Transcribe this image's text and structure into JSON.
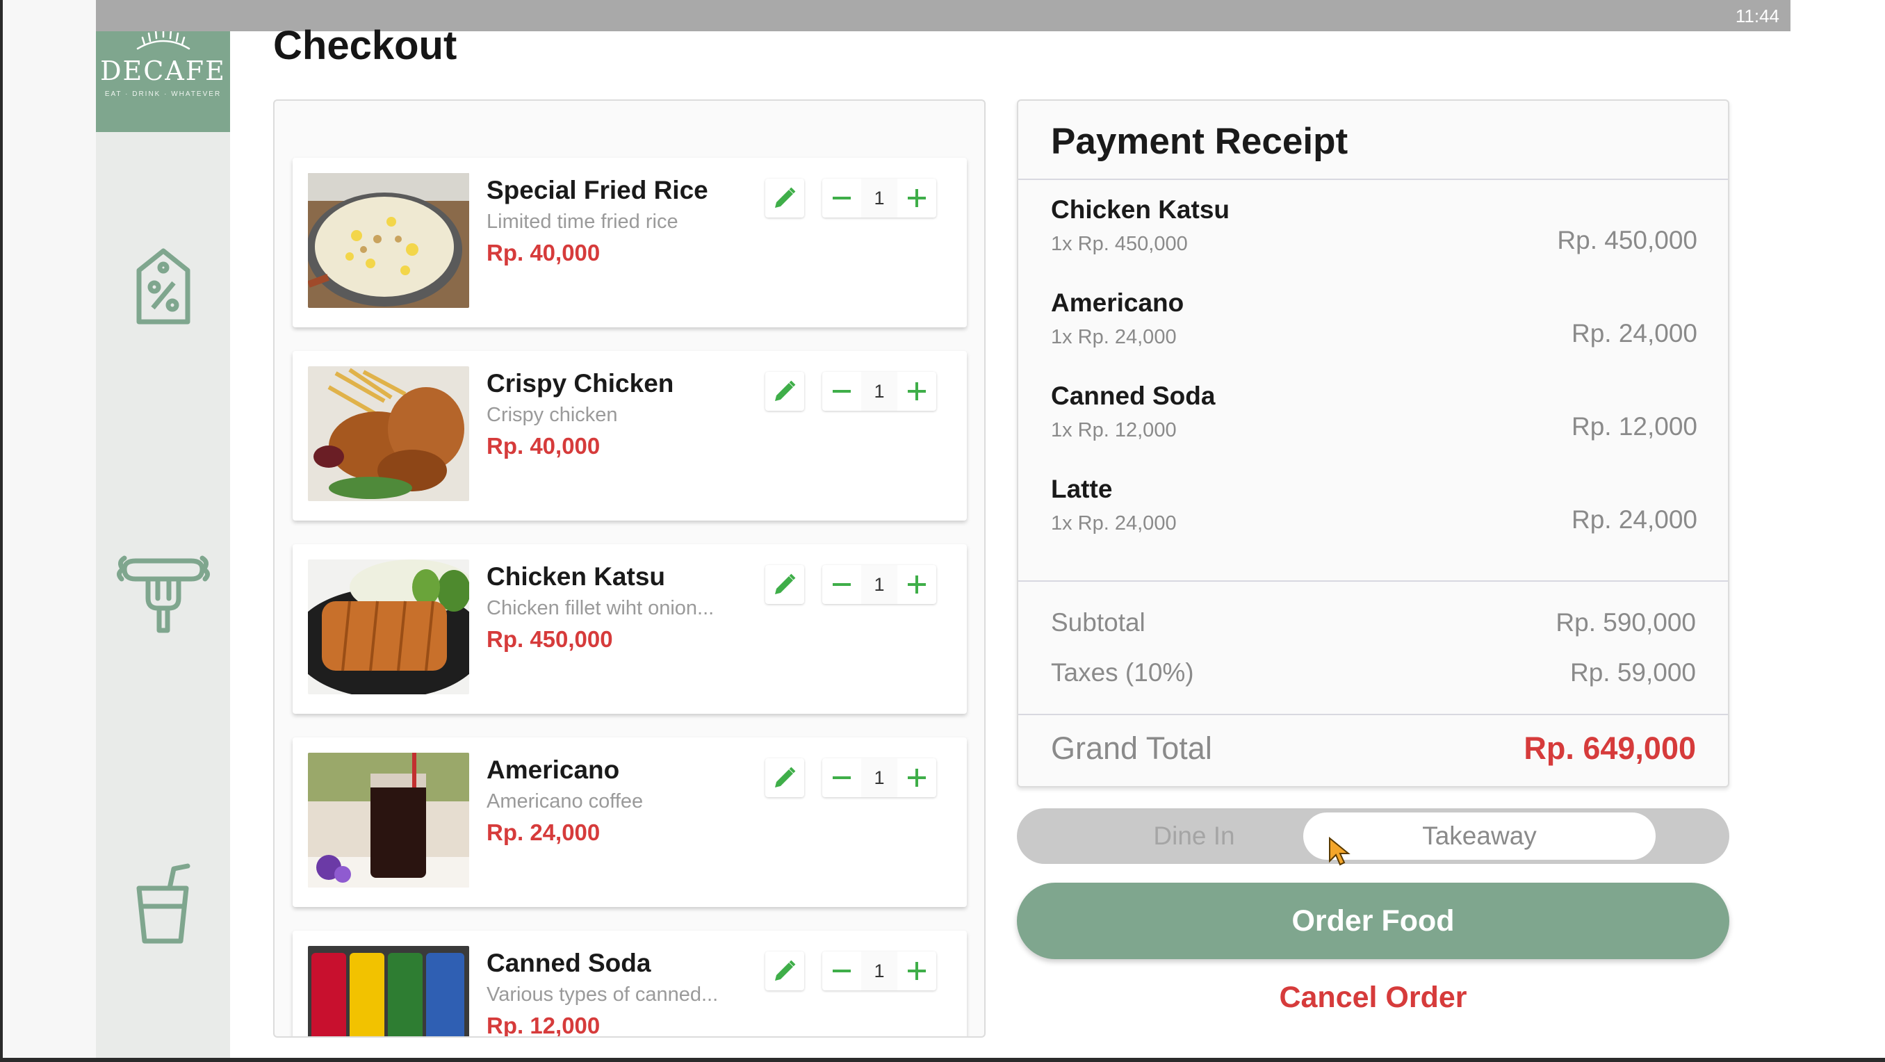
{
  "status_bar": {
    "time": "11:44"
  },
  "brand": {
    "name": "DECAFE",
    "tagline": "EAT · DRINK · WHATEVER"
  },
  "sidebar": {
    "items": [
      {
        "icon": "discount-tag-icon"
      },
      {
        "icon": "food-icon"
      },
      {
        "icon": "drink-icon"
      }
    ]
  },
  "page": {
    "title": "Checkout"
  },
  "cart": {
    "items": [
      {
        "name": "Special Fried Rice",
        "desc": "Limited time fried rice",
        "price": "Rp. 40,000",
        "qty": "1"
      },
      {
        "name": "Crispy Chicken",
        "desc": "Crispy chicken",
        "price": "Rp. 40,000",
        "qty": "1"
      },
      {
        "name": "Chicken Katsu",
        "desc": "Chicken fillet wiht onion...",
        "price": "Rp. 450,000",
        "qty": "1"
      },
      {
        "name": "Americano",
        "desc": "Americano coffee",
        "price": "Rp. 24,000",
        "qty": "1"
      },
      {
        "name": "Canned Soda",
        "desc": "Various types of canned...",
        "price": "Rp. 12,000",
        "qty": "1"
      }
    ]
  },
  "receipt": {
    "title": "Payment Receipt",
    "lines": [
      {
        "name": "Chicken Katsu",
        "qty": "1x Rp. 450,000",
        "total": "Rp. 450,000"
      },
      {
        "name": "Americano",
        "qty": "1x Rp. 24,000",
        "total": "Rp. 24,000"
      },
      {
        "name": "Canned Soda",
        "qty": "1x Rp. 12,000",
        "total": "Rp. 12,000"
      },
      {
        "name": "Latte",
        "qty": "1x Rp. 24,000",
        "total": "Rp. 24,000"
      }
    ],
    "subtotal_label": "Subtotal",
    "subtotal": "Rp. 590,000",
    "tax_label": "Taxes (10%)",
    "tax": "Rp. 59,000",
    "grand_total_label": "Grand Total",
    "grand_total": "Rp. 649,000"
  },
  "order_type": {
    "dine_in": "Dine In",
    "takeaway": "Takeaway",
    "selected": "Takeaway"
  },
  "actions": {
    "order": "Order Food",
    "cancel": "Cancel Order"
  },
  "colors": {
    "brand_green": "#7fa68e",
    "price_red": "#d63b3b",
    "icon_green": "#3fae49"
  }
}
